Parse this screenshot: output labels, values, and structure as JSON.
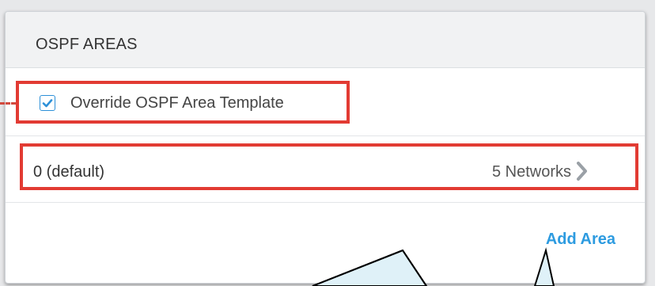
{
  "panel": {
    "title": "OSPF AREAS",
    "override_checkbox": {
      "label": "Override OSPF Area Template",
      "checked": true
    },
    "areas": [
      {
        "name": "0 (default)",
        "networks": "5 Networks"
      }
    ],
    "add_area_label": "Add Area"
  },
  "colors": {
    "accent": "#2d9be0",
    "checkbox_border": "#2d90d8",
    "highlight_red": "#e23b33",
    "callout_fill": "#dff1f8",
    "header_bg": "#f1f2f3"
  },
  "icons": {
    "checkbox": "check-icon",
    "row_navigation": "chevron-right-icon"
  }
}
